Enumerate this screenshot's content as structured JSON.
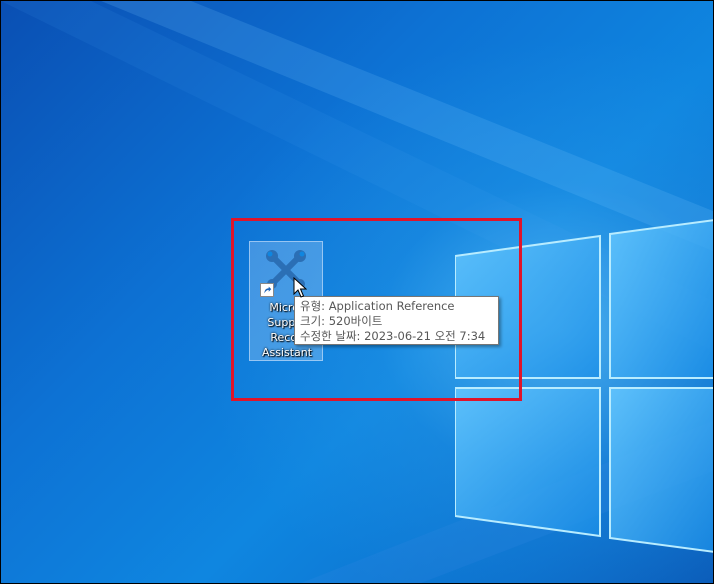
{
  "desktop": {
    "shortcut": {
      "label": "Micros\nSuppor\nRecov\nAssistant",
      "icon": "wrench-screwdriver-icon",
      "overlay_icon": "shortcut-arrow-icon"
    },
    "tooltip": {
      "type_line": "유형: Application Reference",
      "size_line": "크기: 520바이트",
      "modified_line": "수정한 날짜: 2023-06-21 오전 7:34"
    }
  },
  "colors": {
    "highlight": "#e0142a",
    "wallpaper": "#0d72d4"
  }
}
